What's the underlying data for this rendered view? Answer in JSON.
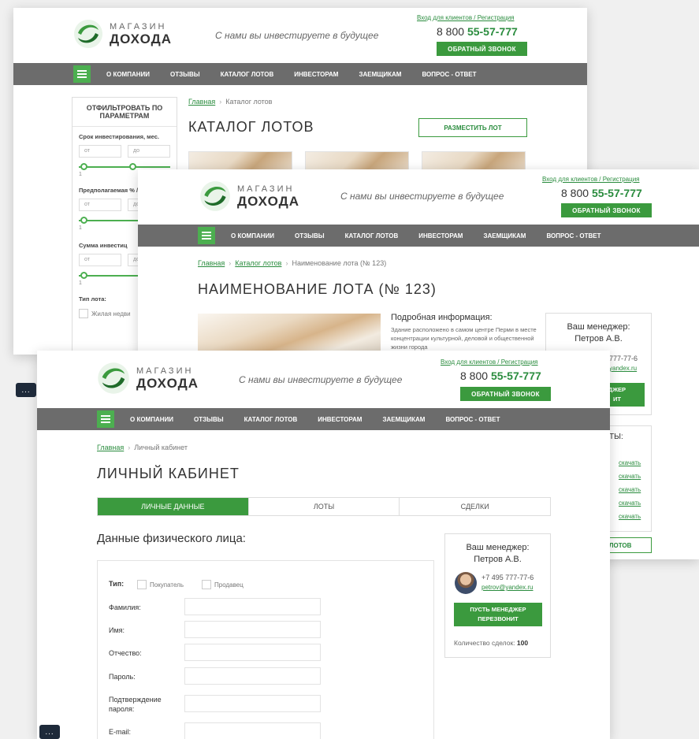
{
  "header": {
    "logo_top": "МАГАЗИН",
    "logo_bottom": "ДОХОДА",
    "tagline": "С нами вы инвестируете в будущее",
    "login_link": "Вход для клиентов / Регистрация",
    "phone_prefix": "8 800 ",
    "phone_number": "55-57-777",
    "callback_button": "ОБРАТНЫЙ ЗВОНОК"
  },
  "nav": {
    "items": [
      "О КОМПАНИИ",
      "ОТЗЫВЫ",
      "КАТАЛОГ ЛОТОВ",
      "ИНВЕСТОРАМ",
      "ЗАЕМЩИКАМ",
      "ВОПРОС - ОТВЕТ"
    ]
  },
  "catalog": {
    "breadcrumb_home": "Главная",
    "breadcrumb_current": "Каталог лотов",
    "title": "КАТАЛОГ ЛОТОВ",
    "place_lot_button": "РАЗМЕСТИТЬ ЛОТ",
    "filter": {
      "title": "ОТФИЛЬТРОВАТЬ ПО ПАРАМЕТРАМ",
      "term_label": "Срок инвестирования, мес.",
      "yield_label": "Предполагаемая % / год",
      "sum_label": "Сумма инвестиц",
      "from": "от",
      "to": "до",
      "min": "1",
      "type_label": "Тип лота:",
      "type_option": "Жилая недви"
    }
  },
  "lot": {
    "breadcrumb_home": "Главная",
    "breadcrumb_catalog": "Каталог лотов",
    "breadcrumb_current": "Наименование лота (№ 123)",
    "title": "НАИМЕНОВАНИЕ ЛОТА (№ 123)",
    "info_title": "Подробная информация:",
    "info_text": "Здание расположено в самом центре Перми в месте концентрации культурной, деловой и общественной жизни города",
    "manager_title": "Ваш менеджер:",
    "manager_name": "Петров А.В.",
    "phone_partial": "777-77-6",
    "email_partial": "yandex.ru",
    "button_partial_1": "ДЖЕР",
    "button_partial_2": "ИТ",
    "docs_partial": "ТЫ:",
    "download": "скачать",
    "catalog_button_partial": "КУ ЛОТОВ"
  },
  "cabinet": {
    "breadcrumb_home": "Главная",
    "breadcrumb_current": "Личный кабинет",
    "title": "ЛИЧНЫЙ КАБИНЕТ",
    "tabs": [
      "ЛИЧНЫЕ ДАННЫЕ",
      "ЛОТЫ",
      "СДЕЛКИ"
    ],
    "section_title": "Данные физического лица:",
    "type_label": "Тип:",
    "type_buyer": "Покупатель",
    "type_seller": "Продавец",
    "fields": [
      "Фамилия:",
      "Имя:",
      "Отчество:",
      "Пароль:",
      "Подтверждение пароля:",
      "E-mail:"
    ],
    "manager": {
      "title": "Ваш менеджер:",
      "name": "Петров А.В.",
      "phone": "+7 495 777-77-6",
      "email": "petrov@yandex.ru",
      "callback_button": "ПУСТЬ МЕНЕДЖЕР ПЕРЕЗВОНИТ",
      "deals_label": "Количество сделок:",
      "deals_count": "100"
    }
  },
  "misc": {
    "more_button": "..."
  },
  "colors": {
    "brand_green": "#3b9a3e",
    "nav_gray": "#6c6c6c"
  }
}
